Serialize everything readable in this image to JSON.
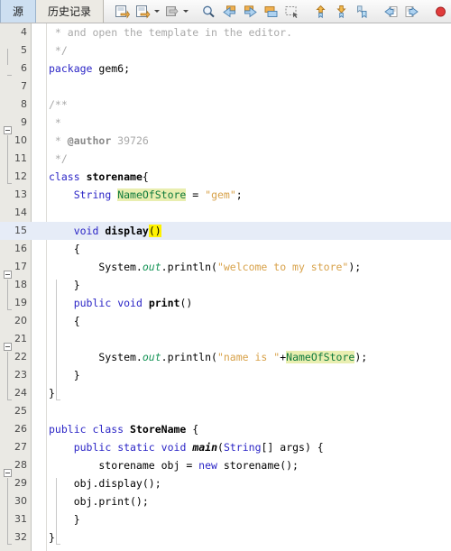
{
  "window": {
    "app": "NetBeans IDE Java Editor"
  },
  "tabs": [
    {
      "label": "源",
      "name": "tab-source",
      "active": true
    },
    {
      "label": "历史记录",
      "name": "tab-history",
      "active": false
    }
  ],
  "toolbar": {
    "groups": [
      {
        "name": "navigation-group",
        "buttons": [
          {
            "name": "last-edit-icon",
            "title": "最后编辑"
          },
          {
            "name": "back-icon",
            "title": "后退",
            "dropdown": true
          },
          {
            "name": "forward-icon",
            "title": "前进",
            "dropdown": true
          }
        ]
      },
      {
        "name": "search-group",
        "buttons": [
          {
            "name": "find-selection-icon",
            "title": "查找选定内容"
          },
          {
            "name": "find-previous-icon",
            "title": "查找上一个"
          },
          {
            "name": "find-next-icon",
            "title": "查找下一个"
          },
          {
            "name": "toggle-highlight-icon",
            "title": "切换高亮显示"
          },
          {
            "name": "toggle-rectangular-selection-icon",
            "title": "矩形选择"
          }
        ]
      },
      {
        "name": "bookmark-group",
        "buttons": [
          {
            "name": "previous-bookmark-icon",
            "title": "上一个书签"
          },
          {
            "name": "next-bookmark-icon",
            "title": "下一个书签"
          },
          {
            "name": "toggle-bookmark-icon",
            "title": "切换书签"
          }
        ]
      },
      {
        "name": "indent-group",
        "buttons": [
          {
            "name": "shift-left-icon",
            "title": "左移"
          },
          {
            "name": "shift-right-icon",
            "title": "右移"
          }
        ]
      },
      {
        "name": "macro-group",
        "buttons": [
          {
            "name": "start-macro-recording-icon",
            "title": "开始录制宏"
          },
          {
            "name": "stop-macro-recording-icon",
            "title": "停止录制宏"
          },
          {
            "name": "inspect-members-icon",
            "title": "检查成员"
          }
        ]
      }
    ]
  },
  "editor": {
    "current_line": 15,
    "first_visible_line": 4,
    "last_visible_line": 32,
    "colors": {
      "keyword": "#2b25c6",
      "comment": "#a9a9a9",
      "string": "#d8a24a",
      "field": "#0e7a3c",
      "static_field": "#169457",
      "search_highlight": "#e9eeb0",
      "caret_brace_highlight": "#fff200",
      "current_line": "#e6ecf7",
      "gutter_bg": "#eae9e4"
    },
    "lines": [
      {
        "n": 4,
        "text": " * and open the template in the editor."
      },
      {
        "n": 5,
        "text": " */"
      },
      {
        "n": 6,
        "text": "package gem6;"
      },
      {
        "n": 7,
        "text": ""
      },
      {
        "n": 8,
        "text": "/**"
      },
      {
        "n": 9,
        "text": " *"
      },
      {
        "n": 10,
        "text": " * @author 39726"
      },
      {
        "n": 11,
        "text": " */"
      },
      {
        "n": 12,
        "text": "class storename{"
      },
      {
        "n": 13,
        "text": "    String NameOfStore = \"gem\";"
      },
      {
        "n": 14,
        "text": ""
      },
      {
        "n": 15,
        "text": "    void display()"
      },
      {
        "n": 16,
        "text": "    {"
      },
      {
        "n": 17,
        "text": "        System.out.println(\"welcome to my store\");"
      },
      {
        "n": 18,
        "text": "    }"
      },
      {
        "n": 19,
        "text": "    public void print()"
      },
      {
        "n": 20,
        "text": "    {"
      },
      {
        "n": 21,
        "text": ""
      },
      {
        "n": 22,
        "text": "        System.out.println(\"name is \"+NameOfStore);"
      },
      {
        "n": 23,
        "text": "    }"
      },
      {
        "n": 24,
        "text": "}"
      },
      {
        "n": 25,
        "text": ""
      },
      {
        "n": 26,
        "text": "public class StoreName {"
      },
      {
        "n": 27,
        "text": "    public static void main(String[] args) {"
      },
      {
        "n": 28,
        "text": "        storename obj = new storename();"
      },
      {
        "n": 29,
        "text": "    obj.display();"
      },
      {
        "n": 30,
        "text": "    obj.print();"
      },
      {
        "n": 31,
        "text": "    }"
      },
      {
        "n": 32,
        "text": "}"
      }
    ]
  }
}
